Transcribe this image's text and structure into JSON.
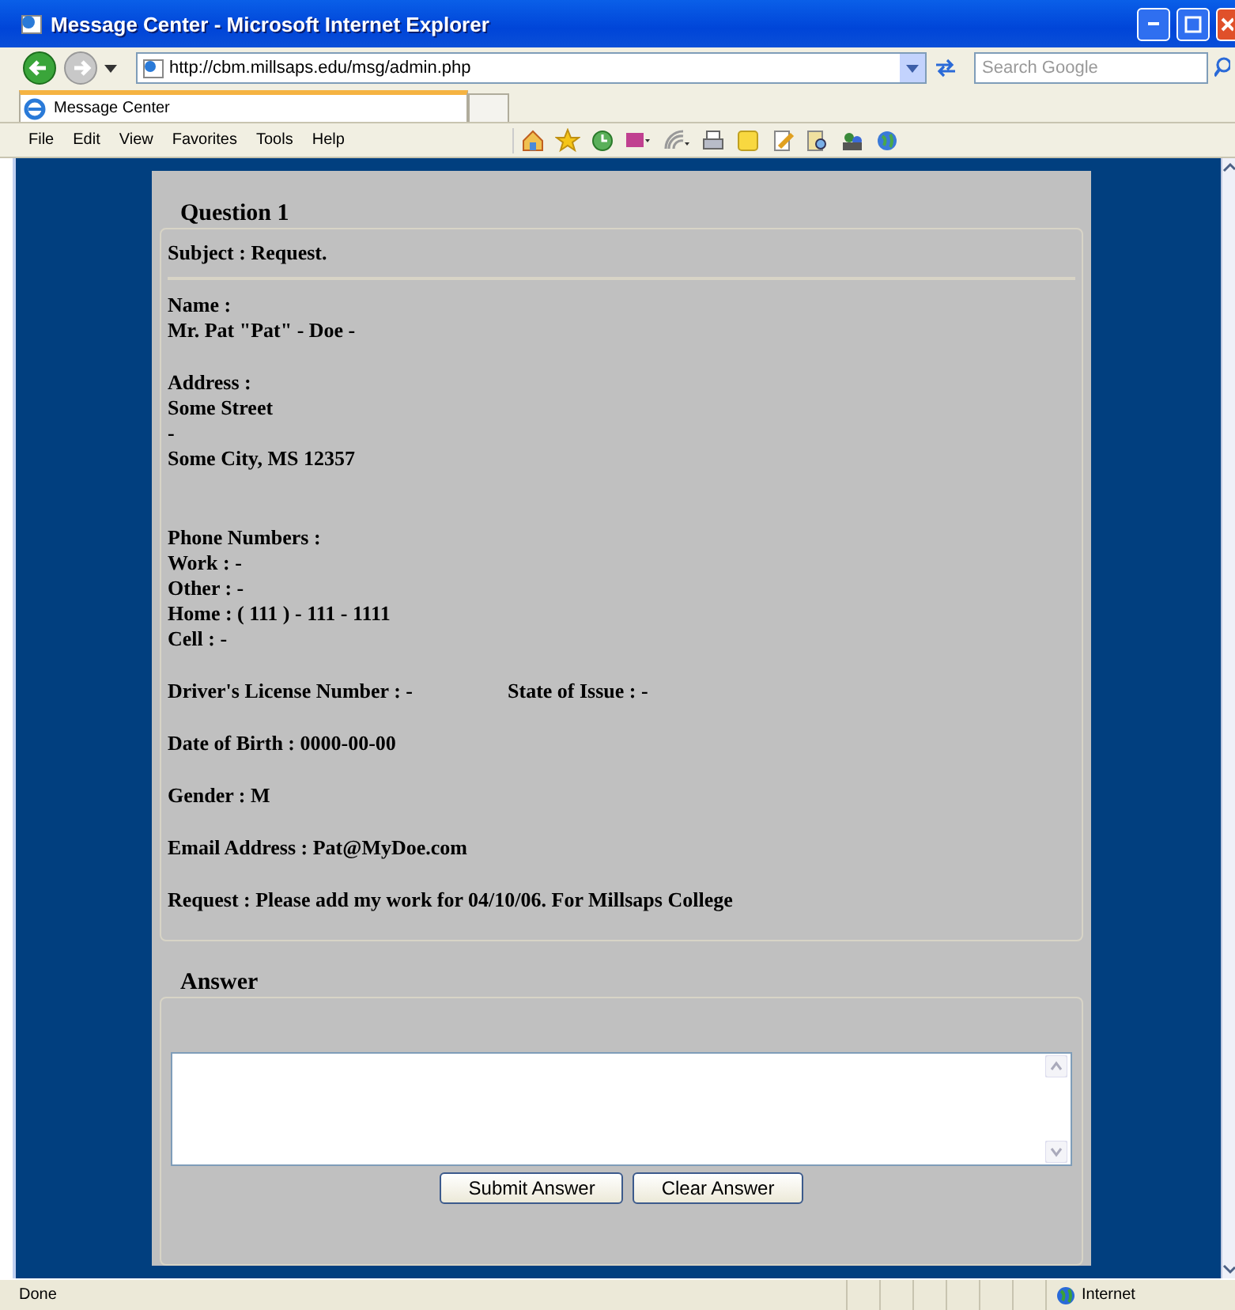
{
  "window": {
    "title": "Message Center - Microsoft Internet Explorer"
  },
  "address_bar": {
    "url": "http://cbm.millsaps.edu/msg/admin.php"
  },
  "search": {
    "placeholder": "Search Google"
  },
  "tabs": [
    {
      "label": "Message Center",
      "selected": true
    }
  ],
  "menu": [
    "File",
    "Edit",
    "View",
    "Favorites",
    "Tools",
    "Help"
  ],
  "question": {
    "legend": "Question 1",
    "subject": "Subject : Request.",
    "blocks": [
      {
        "kind": "lines",
        "lines": [
          "Name :",
          "Mr. Pat \"Pat\" - Doe -"
        ]
      },
      {
        "kind": "lines",
        "lines": [
          "Address :",
          "Some Street",
          "-",
          "Some City, MS 12357"
        ]
      },
      {
        "kind": "lines",
        "lines": [
          "Phone Numbers :",
          "Work : -",
          "Other : -",
          "Home : ( 111 ) - 111 - 1111",
          "Cell : -"
        ]
      },
      {
        "kind": "pair",
        "lines": [
          "Driver's License Number : -",
          "State of Issue : -"
        ]
      },
      {
        "kind": "lines",
        "lines": [
          "Date of Birth : 0000-00-00"
        ]
      },
      {
        "kind": "lines",
        "lines": [
          "Gender : M"
        ]
      },
      {
        "kind": "lines",
        "lines": [
          "Email Address : Pat@MyDoe.com"
        ]
      },
      {
        "kind": "lines",
        "lines": [
          "Request : Please add my work for 04/10/06. For Millsaps College"
        ]
      }
    ]
  },
  "answer": {
    "legend": "Answer",
    "buttons": [
      "Submit Answer",
      "Clear Answer"
    ]
  },
  "status_bar": {
    "status": "Done",
    "zone": "Internet"
  }
}
